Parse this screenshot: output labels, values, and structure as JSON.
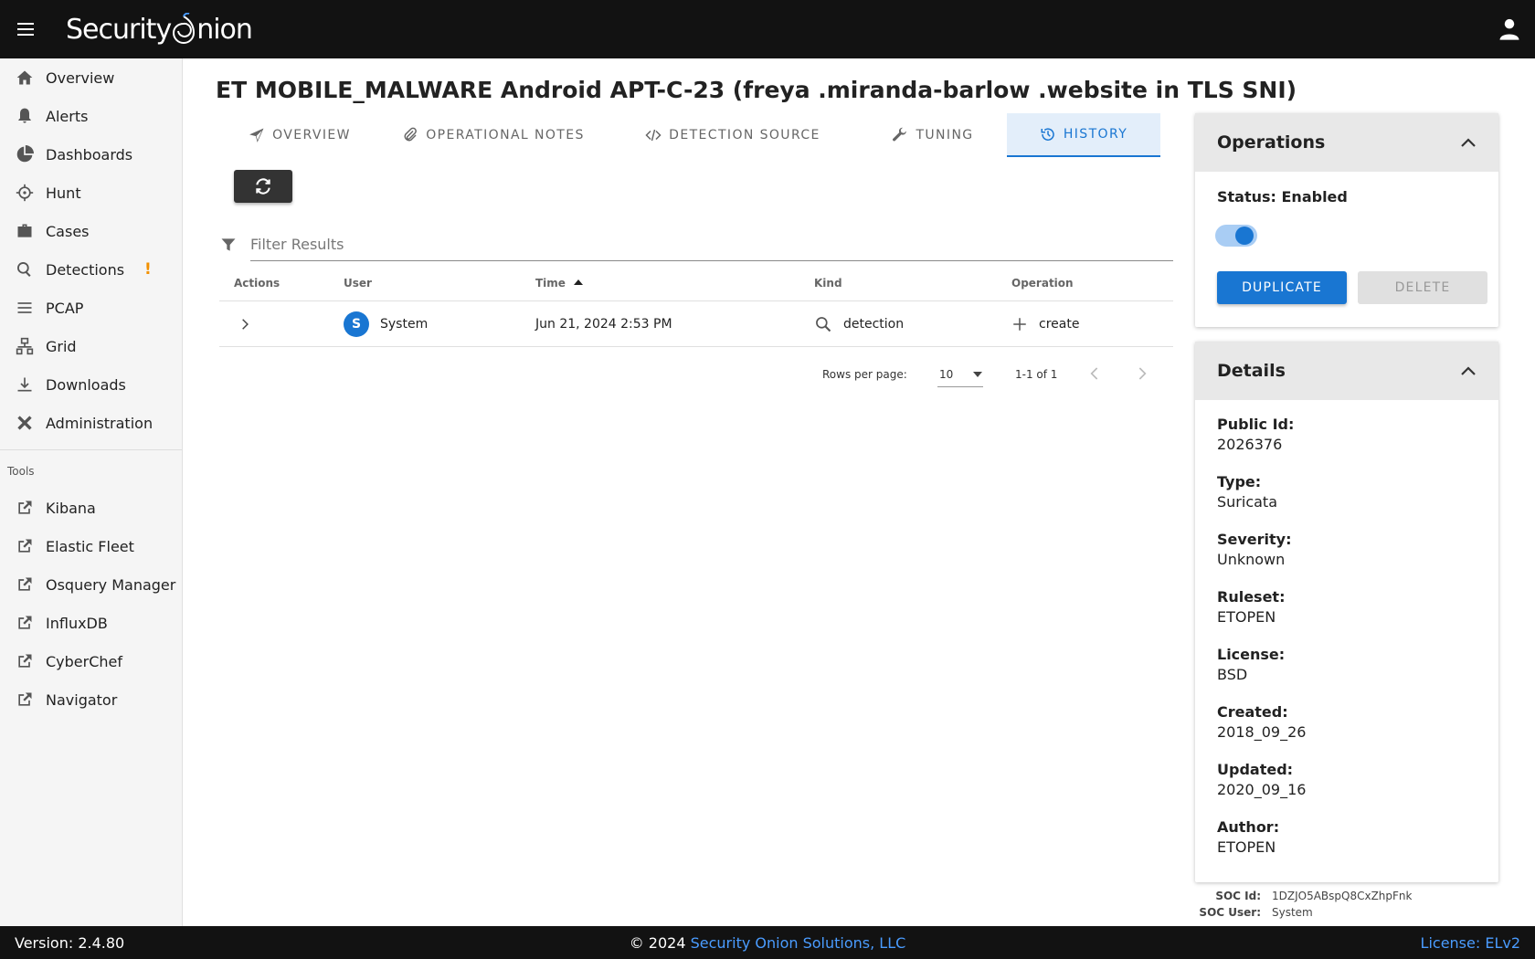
{
  "app": {
    "logo_left": "Security",
    "logo_right": "nion"
  },
  "sidebar": {
    "items": [
      {
        "label": "Overview",
        "icon": "home-icon"
      },
      {
        "label": "Alerts",
        "icon": "bell-icon"
      },
      {
        "label": "Dashboards",
        "icon": "pie-chart-icon"
      },
      {
        "label": "Hunt",
        "icon": "crosshairs-icon"
      },
      {
        "label": "Cases",
        "icon": "briefcase-icon"
      },
      {
        "label": "Detections",
        "icon": "search-icon",
        "warning": "!"
      },
      {
        "label": "PCAP",
        "icon": "lines-icon"
      },
      {
        "label": "Grid",
        "icon": "network-icon"
      },
      {
        "label": "Downloads",
        "icon": "download-icon"
      },
      {
        "label": "Administration",
        "icon": "tools-icon"
      }
    ],
    "tools_header": "Tools",
    "tools": [
      {
        "label": "Kibana"
      },
      {
        "label": "Elastic Fleet"
      },
      {
        "label": "Osquery Manager"
      },
      {
        "label": "InfluxDB"
      },
      {
        "label": "CyberChef"
      },
      {
        "label": "Navigator"
      }
    ]
  },
  "page": {
    "title": "ET MOBILE_MALWARE Android APT-C-23 (freya .miranda-barlow .website in TLS SNI)",
    "tabs": [
      {
        "label": "OVERVIEW",
        "icon": "send-icon"
      },
      {
        "label": "OPERATIONAL NOTES",
        "icon": "paperclip-icon"
      },
      {
        "label": "DETECTION SOURCE",
        "icon": "code-icon"
      },
      {
        "label": "TUNING",
        "icon": "wrench-icon"
      },
      {
        "label": "HISTORY",
        "icon": "history-icon",
        "active": true
      }
    ],
    "filter_placeholder": "Filter Results"
  },
  "table": {
    "headers": [
      "Actions",
      "User",
      "Time",
      "Kind",
      "Operation"
    ],
    "sort_column": "Time",
    "sort_direction": "ascending",
    "rows": [
      {
        "avatar_letter": "S",
        "user": "System",
        "time": "Jun 21, 2024 2:53 PM",
        "kind": "detection",
        "operation": "create"
      }
    ],
    "pager": {
      "rows_per_page_label": "Rows per page:",
      "rows_per_page": "10",
      "range": "1-1 of 1"
    }
  },
  "operations": {
    "title": "Operations",
    "status": "Status: Enabled",
    "enabled": true,
    "duplicate_label": "DUPLICATE",
    "delete_label": "DELETE"
  },
  "details": {
    "title": "Details",
    "fields": [
      {
        "label": "Public Id:",
        "value": "2026376"
      },
      {
        "label": "Type:",
        "value": "Suricata"
      },
      {
        "label": "Severity:",
        "value": "Unknown"
      },
      {
        "label": "Ruleset:",
        "value": "ETOPEN"
      },
      {
        "label": "License:",
        "value": "BSD"
      },
      {
        "label": "Created:",
        "value": "2018_09_26"
      },
      {
        "label": "Updated:",
        "value": "2020_09_16"
      },
      {
        "label": "Author:",
        "value": "ETOPEN"
      }
    ],
    "soc_id_label": "SOC Id:",
    "soc_id": "1DZJO5ABspQ8CxZhpFnk",
    "soc_user_label": "SOC User:",
    "soc_user": "System"
  },
  "footer": {
    "version": "Version: 2.4.80",
    "copyright": "© 2024",
    "company": "Security Onion Solutions, LLC",
    "license": "License: ELv2"
  },
  "colors": {
    "topbar": "#121212",
    "accent": "#1976d2",
    "link": "#4a9cff",
    "warning": "#f29000"
  }
}
